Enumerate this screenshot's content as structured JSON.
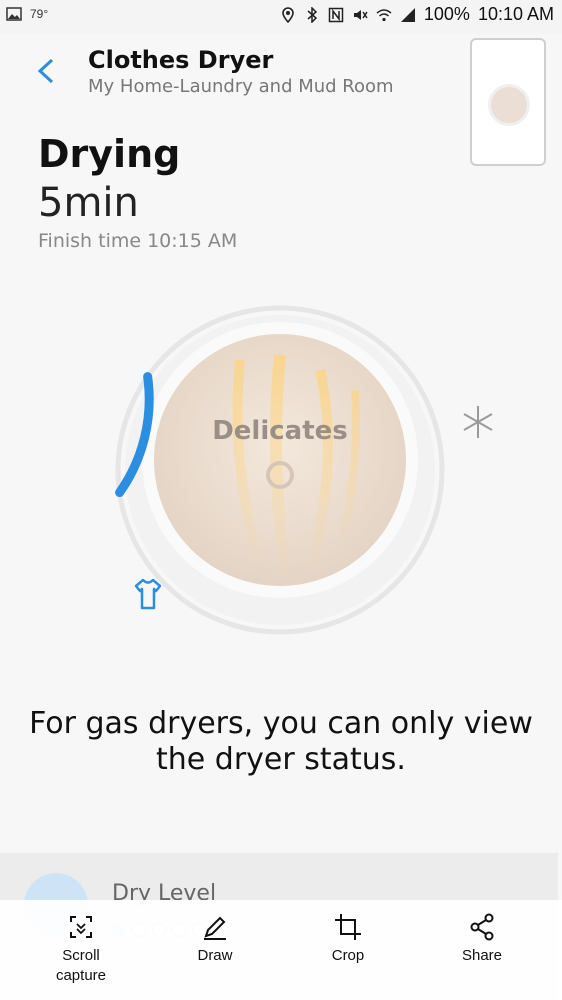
{
  "status_bar": {
    "temperature": "79°",
    "battery": "100%",
    "time": "10:10 AM"
  },
  "header": {
    "title": "Clothes Dryer",
    "subtitle": "My Home-Laundry and Mud Room"
  },
  "status": {
    "state": "Drying",
    "remaining": "5min",
    "finish_time": "Finish time 10:15 AM",
    "progress_fraction": 0.12
  },
  "dial": {
    "cycle_label": "Delicates"
  },
  "message": {
    "line1": "For gas dryers, you can only view",
    "line2": "the dryer status."
  },
  "card": {
    "label": "Dry Level",
    "level_index": 0,
    "levels": 5
  },
  "toolbar": {
    "scroll_capture_line1": "Scroll",
    "scroll_capture_line2": "capture",
    "draw": "Draw",
    "crop": "Crop",
    "share": "Share"
  },
  "colors": {
    "accent": "#2b8ee0",
    "dial_fill": "#eaded5"
  }
}
